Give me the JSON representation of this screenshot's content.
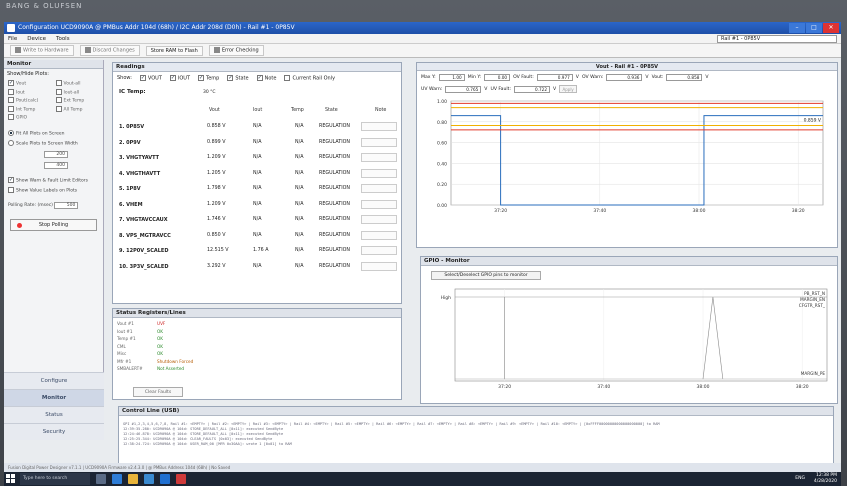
{
  "brand": "BANG & OLUFSEN",
  "window": {
    "title": "Configuration UCD9090A @ PMBus Addr 104d (68h) / I2C Addr 208d (D0h) - Rail #1 - 0P85V",
    "minimize": "–",
    "maximize": "□",
    "close": "✕"
  },
  "menu": {
    "items": [
      "File",
      "Device",
      "Tools"
    ]
  },
  "rail_select": "Rail #1 - 0P85V",
  "toolbar": {
    "write": "Write to Hardware",
    "discard": "Discard Changes",
    "store": "Store RAM to Flash",
    "error": "Error Checking"
  },
  "monitor": {
    "title": "Monitor",
    "show_hide": "Show/Hide Plots:",
    "checks": [
      {
        "label": "Vout",
        "checked": true
      },
      {
        "label": "Vout-all",
        "checked": false
      },
      {
        "label": "Iout",
        "checked": false
      },
      {
        "label": "Iout-all",
        "checked": false
      },
      {
        "label": "Pout(calc)",
        "checked": false
      },
      {
        "label": "Ext Temp",
        "checked": false
      },
      {
        "label": "Int Temp",
        "checked": false
      },
      {
        "label": "All Temp",
        "checked": false
      },
      {
        "label": "GPIO",
        "checked": false
      }
    ],
    "fit_all": "Fit All Plots on Screen",
    "scale": "Scale Plots to Screen Width",
    "width_val": "200",
    "height_val": "400",
    "show_warn": "Show Warn & Fault Limit Editors",
    "show_values": "Show Value Labels on Plots",
    "polling_label": "Polling Rate: (msec)",
    "polling_val": "500",
    "stop": "Stop Polling"
  },
  "nav": [
    {
      "label": "Configure",
      "active": false
    },
    {
      "label": "Monitor",
      "active": true
    },
    {
      "label": "Status",
      "active": false
    },
    {
      "label": "Security",
      "active": false
    }
  ],
  "readings": {
    "title": "Readings",
    "show": "Show:",
    "show_items": [
      {
        "label": "VOUT",
        "checked": true
      },
      {
        "label": "IOUT",
        "checked": true
      },
      {
        "label": "Temp",
        "checked": true
      },
      {
        "label": "State",
        "checked": true
      },
      {
        "label": "Note",
        "checked": true
      },
      {
        "label": "Current Rail Only",
        "checked": false
      }
    ],
    "ic_temp_label": "IC Temp:",
    "ic_temp_value": "30 °C",
    "headers": [
      "Vout",
      "Iout",
      "Temp",
      "State",
      "Note"
    ],
    "rows": [
      {
        "name": "1. 0P85V",
        "vout": "0.858 V",
        "iout": "N/A",
        "temp": "N/A",
        "state": "REGULATION"
      },
      {
        "name": "2. 0P9V",
        "vout": "0.899 V",
        "iout": "N/A",
        "temp": "N/A",
        "state": "REGULATION"
      },
      {
        "name": "3. VHGTYAVTT",
        "vout": "1.209 V",
        "iout": "N/A",
        "temp": "N/A",
        "state": "REGULATION"
      },
      {
        "name": "4. VHGTHAVTT",
        "vout": "1.205 V",
        "iout": "N/A",
        "temp": "N/A",
        "state": "REGULATION"
      },
      {
        "name": "5. 1P8V",
        "vout": "1.798 V",
        "iout": "N/A",
        "temp": "N/A",
        "state": "REGULATION"
      },
      {
        "name": "6. VHEM",
        "vout": "1.209 V",
        "iout": "N/A",
        "temp": "N/A",
        "state": "REGULATION"
      },
      {
        "name": "7. VHGTAVCCAUX",
        "vout": "1.746 V",
        "iout": "N/A",
        "temp": "N/A",
        "state": "REGULATION"
      },
      {
        "name": "8. VPS_MGTRAVCC",
        "vout": "0.850 V",
        "iout": "N/A",
        "temp": "N/A",
        "state": "REGULATION"
      },
      {
        "name": "9. 12P0V_SCALED",
        "vout": "12.515 V",
        "iout": "1.76 A",
        "temp": "N/A",
        "state": "REGULATION"
      },
      {
        "name": "10. 3P3V_SCALED",
        "vout": "3.292 V",
        "iout": "N/A",
        "temp": "N/A",
        "state": "REGULATION"
      }
    ]
  },
  "status": {
    "title": "Status Registers/Lines",
    "rows": [
      {
        "k": "Vout #1",
        "v": "UVF",
        "tone": "red"
      },
      {
        "k": "Iout #1",
        "v": "OK",
        "tone": "green"
      },
      {
        "k": "Temp #1",
        "v": "OK",
        "tone": "green"
      },
      {
        "k": "CML",
        "v": "OK",
        "tone": "green"
      },
      {
        "k": "Misc",
        "v": "OK",
        "tone": "green"
      },
      {
        "k": "Mfr #1",
        "v": "Shutdown Forced",
        "tone": "orange"
      },
      {
        "k": "SMBALERT#",
        "v": "Not Asserted",
        "tone": "green"
      }
    ],
    "clear": "Clear Faults"
  },
  "control": {
    "title": "Control Line (USB)",
    "log": [
      "GPI #1,2,3,4,5,6,7,8, Rail #1: <EMPTY> | Rail #2: <EMPTY> | Rail #3: <EMPTY> | Rail #4: <EMPTY> | Rail #5: <EMPTY> | Rail #6: <EMPTY> | Rail #7: <EMPTY> | Rail #8: <EMPTY> | Rail #9: <EMPTY> | Rail #10: <EMPTY> | [0xFFFF00000000000000000000] to RAM",
      "12:39:35.280: UCD9090A @ 104d: STORE_DEFAULT_ALL [0x11]: executed SendByte",
      "12:24:46.878: UCD9090A @ 104d: STORE_DEFAULT_ALL [0x11]: executed SendByte",
      "12:25:25.344: UCD9090A @ 104d: CLEAR_FAULTS [0x03]: executed SendByte",
      "12:38:24.724: UCD9090A @ 104d: USER_RAM_00 [MFR 0x30AA]: wrote 1 [0x01] to RAM"
    ]
  },
  "vout_chart": {
    "title": "Vout - Rail #1 - 0P85V",
    "limits": {
      "max_y_label": "Max Y:",
      "max_y": "1.00",
      "min_y_label": "Min Y:",
      "min_y": "0.00",
      "ov_fault_label": "OV Fault:",
      "ov_fault": "0.977",
      "ov_warn_label": "OV Warn:",
      "ov_warn": "0.936",
      "vout_label": "Vout:",
      "vout": "0.858",
      "uv_warn_label": "UV Warn:",
      "uv_warn": "0.765",
      "uv_fault_label": "UV Fault:",
      "uv_fault": "0.722",
      "unit": "V",
      "apply": "Apply"
    }
  },
  "gpio_chart": {
    "title": "GPIO - Monitor",
    "select_btn": "Select/Deselect GPIO pins to monitor",
    "high_label": "High",
    "pins": [
      "PB_RST_N",
      "MARGIN_EN",
      "CFGTR_RST_",
      "MARGIN_PE"
    ]
  },
  "chart_data": [
    {
      "type": "line",
      "title": "Vout - Rail #1 - 0P85V",
      "x_ticks": [
        "37:20",
        "37:40",
        "38:00",
        "38:20"
      ],
      "ylim": [
        0.0,
        1.0
      ],
      "y_ticks": [
        "1.00",
        "0.80",
        "0.60",
        "0.40",
        "0.20",
        "0.00"
      ],
      "grid": true,
      "series": [
        {
          "name": "",
          "color": "#2a6ebd",
          "x": [
            "37:10",
            "37:19",
            "37:20",
            "37:20",
            "37:58",
            "38:01",
            "38:01",
            "38:25"
          ],
          "y": [
            0.859,
            0.859,
            0.859,
            0.0,
            0.0,
            0.0,
            0.859,
            0.859
          ]
        },
        {
          "name": "",
          "color": "#e23a2a",
          "x": [
            "37:10",
            "38:25"
          ],
          "y": [
            0.977,
            0.977
          ]
        },
        {
          "name": "",
          "color": "#f0b000",
          "x": [
            "37:10",
            "38:25"
          ],
          "y": [
            0.936,
            0.936
          ]
        },
        {
          "name": "",
          "color": "#f0b000",
          "x": [
            "37:10",
            "38:25"
          ],
          "y": [
            0.765,
            0.765
          ]
        },
        {
          "name": "",
          "color": "#e23a2a",
          "x": [
            "37:10",
            "38:25"
          ],
          "y": [
            0.722,
            0.722
          ]
        }
      ],
      "value_label": "0.859 V"
    },
    {
      "type": "line",
      "title": "GPIO - Monitor",
      "x_ticks": [
        "37:20",
        "37:40",
        "38:00",
        "38:20"
      ],
      "series": [
        {
          "name": "PB_RST_N"
        },
        {
          "name": "MARGIN_EN"
        },
        {
          "name": "CFGTR_RST_"
        },
        {
          "name": "MARGIN_PE"
        }
      ]
    }
  ],
  "taskbar": {
    "search": "Type here to search",
    "time": "12:38 PM",
    "date": "4/28/2020",
    "lang": "ENG"
  },
  "status_bar": "Fusion Digital Power Designer v7.1.1 | UCD9090A Firmware v2.4.3.0 | @ PMBus Address 104d (68h) | No Saved"
}
